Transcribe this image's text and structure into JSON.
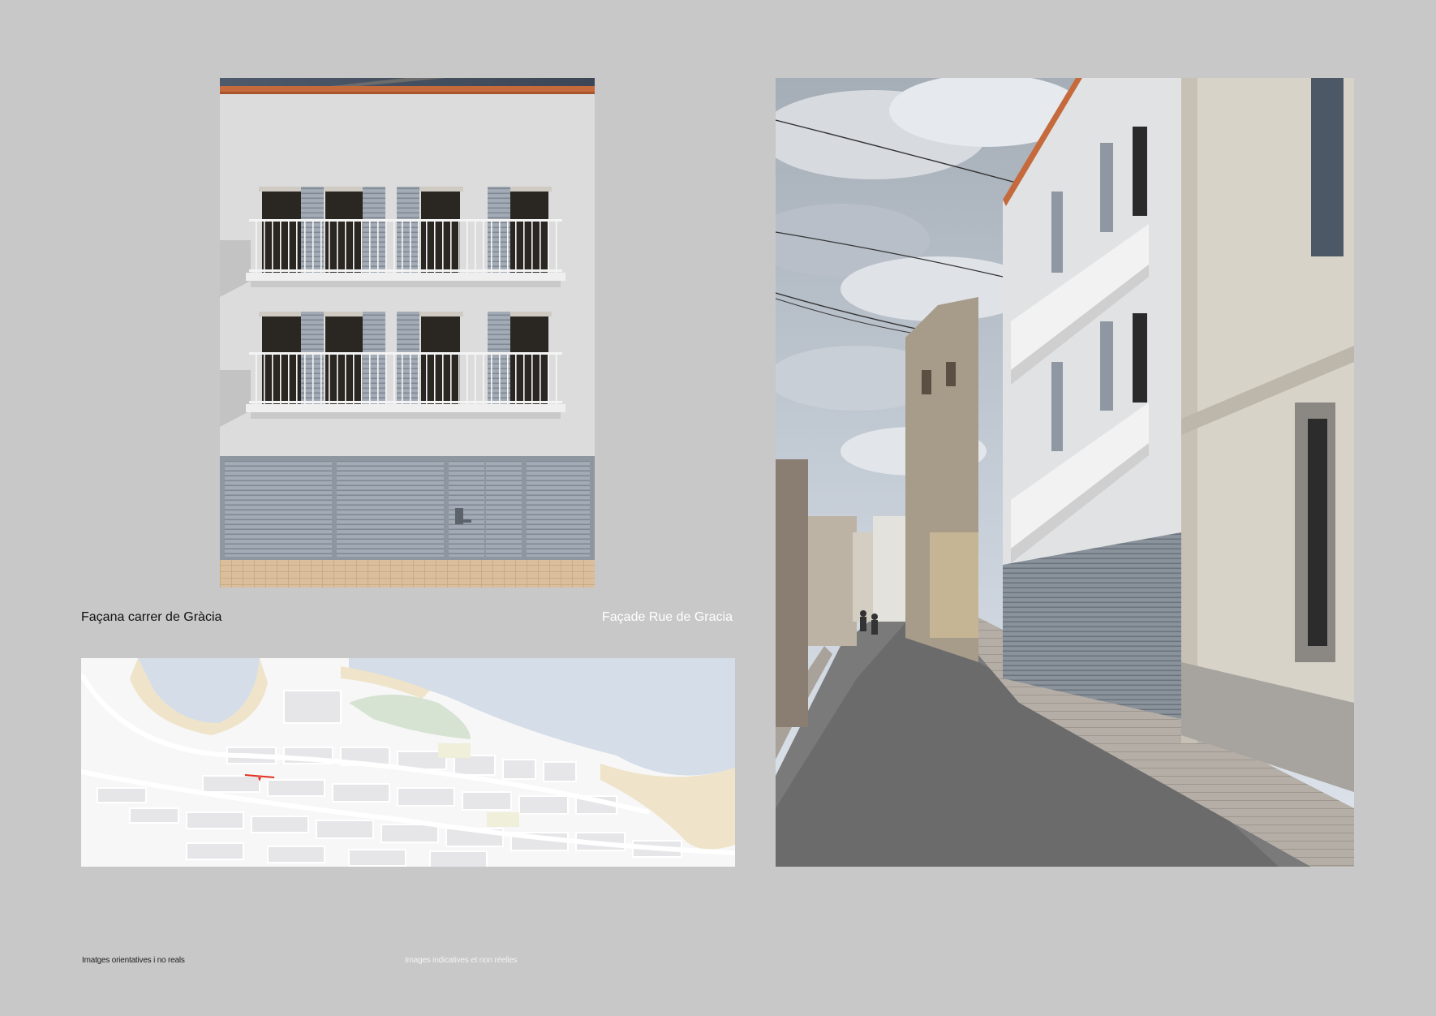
{
  "captions": {
    "facade_ca": "Façana carrer de Gràcia",
    "facade_fr": "Façade Rue de  Gracia"
  },
  "notes": {
    "disclaimer_ca": "Imatges orientatives i no reals",
    "disclaimer_fr": "Images indicatives et non réelles"
  },
  "colors": {
    "page_background": "#c8c8c8",
    "facade_wall": "#dcdcdc",
    "shutters": "#9aa3ad",
    "cornice": "#c46a3c",
    "map_sea": "#d4dde8",
    "map_beach": "#efe3c9",
    "map_green": "#d6e3d3",
    "map_marker": "#e0301e"
  }
}
